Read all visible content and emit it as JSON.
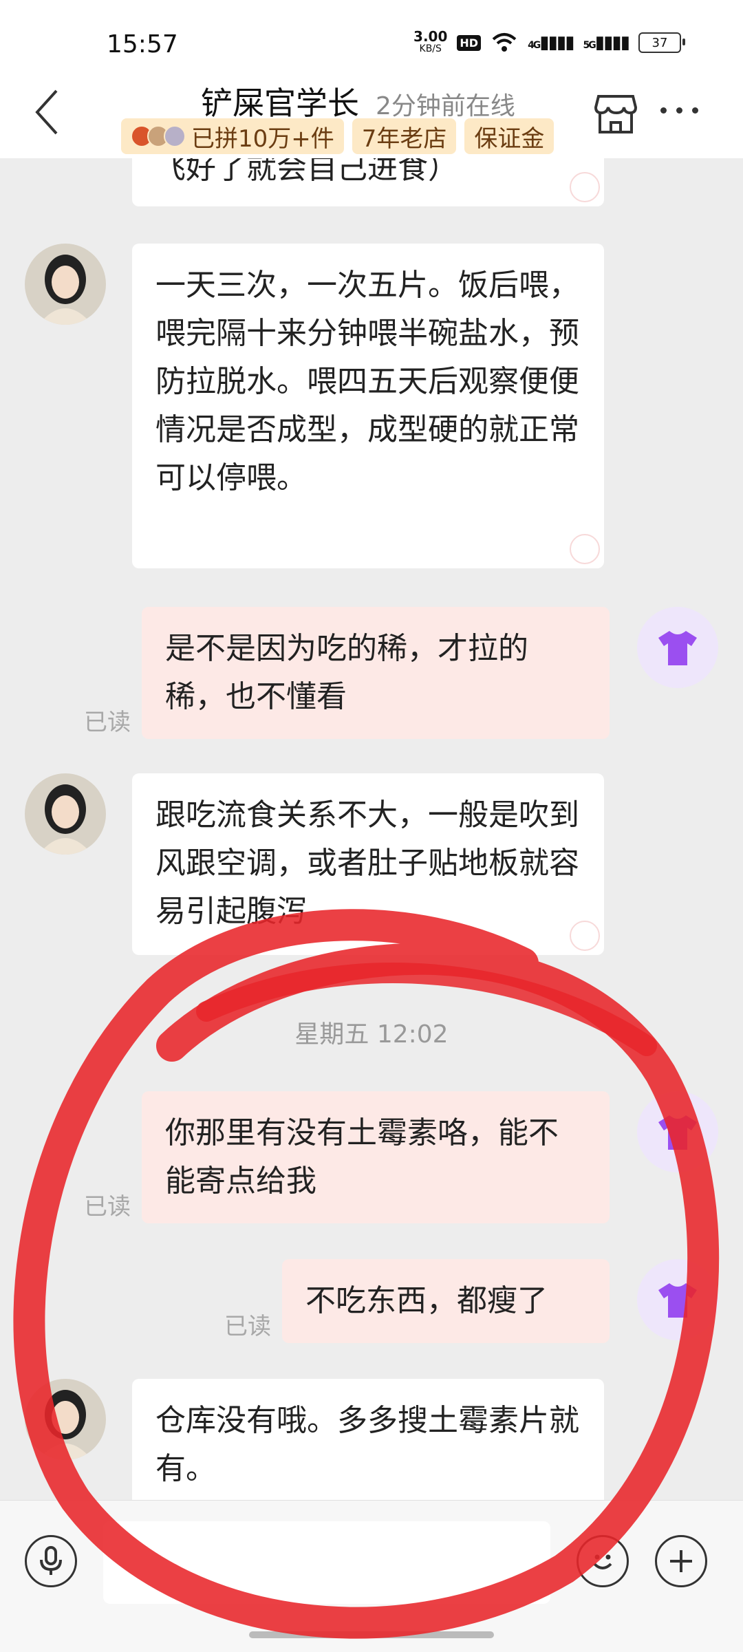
{
  "status_bar": {
    "time": "15:57",
    "net_speed": "3.00",
    "net_speed_unit": "KB/S",
    "hd_label": "HD",
    "signal_1_label": "4G",
    "signal_2_label": "5G",
    "battery": "37"
  },
  "header": {
    "title": "铲屎官学长",
    "subtitle": "2分钟前在线",
    "badges": [
      "已拼10万+件",
      "7年老店",
      "保证金"
    ]
  },
  "messages": [
    {
      "side": "left",
      "text": "飞好了就会自己进食）",
      "partial": true
    },
    {
      "side": "left",
      "text": "一天三次，一次五片。饭后喂，喂完隔十来分钟喂半碗盐水，预防拉脱水。喂四五天后观察便便情况是否成型，成型硬的就正常可以停喂。"
    },
    {
      "side": "right",
      "text": "是不是因为吃的稀，才拉的稀，也不懂看",
      "read": "已读"
    },
    {
      "side": "left",
      "text": "跟吃流食关系不大，一般是吹到风跟空调，或者肚子贴地板就容易引起腹泻"
    },
    {
      "side": "time",
      "text": "星期五 12:02"
    },
    {
      "side": "right",
      "text": "你那里有没有土霉素咯，能不能寄点给我",
      "read": "已读"
    },
    {
      "side": "right",
      "text": "不吃东西，都瘦了",
      "read": "已读"
    },
    {
      "side": "left",
      "text": "仓库没有哦。多多搜土霉素片就有。"
    }
  ],
  "colors": {
    "left_bubble": "#ffffff",
    "right_bubble": "#fde9e6",
    "badge_bg": "#fde9c6",
    "annotation_circle": "#e8262a",
    "shirt_icon": "#9b4ff0"
  }
}
